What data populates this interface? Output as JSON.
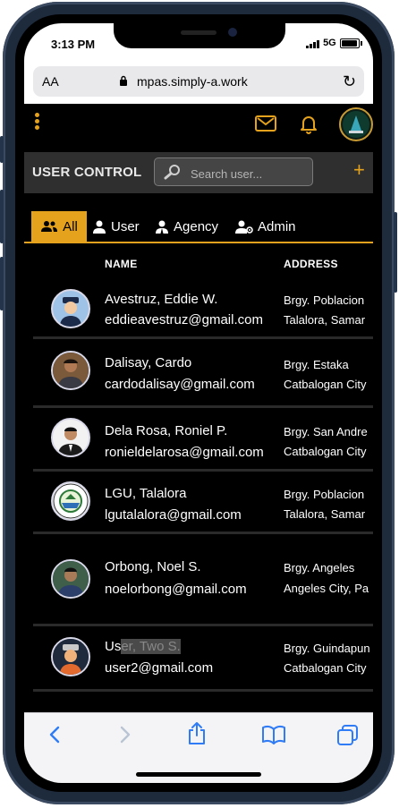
{
  "status_bar": {
    "time": "3:13 PM",
    "network": "5G"
  },
  "browser": {
    "text_size": "AA",
    "url": "mpas.simply-a.work"
  },
  "control": {
    "title": "USER CONTROL",
    "search_placeholder": "Search user..."
  },
  "tabs": [
    {
      "label": "All",
      "icon": "users-group-icon",
      "active": true
    },
    {
      "label": "User",
      "icon": "user-icon",
      "active": false
    },
    {
      "label": "Agency",
      "icon": "agency-user-icon",
      "active": false
    },
    {
      "label": "Admin",
      "icon": "admin-user-gear-icon",
      "active": false
    }
  ],
  "table": {
    "headers": {
      "name": "NAME",
      "address": "ADDRESS"
    },
    "rows": [
      {
        "name": "Avestruz, Eddie W.",
        "email": "eddieavestruz@gmail.com",
        "address_line1": "Brgy. Poblacion",
        "address_line2": "Talalora, Samar"
      },
      {
        "name": "Dalisay, Cardo",
        "email": "cardodalisay@gmail.com",
        "address_line1": "Brgy. Estaka",
        "address_line2": "Catbalogan City"
      },
      {
        "name": "Dela Rosa, Roniel P.",
        "email": "ronieldelarosa@gmail.com",
        "address_line1": "Brgy. San Andre",
        "address_line2": "Catbalogan City"
      },
      {
        "name": "LGU, Talalora",
        "email": "lgutalalora@gmail.com",
        "address_line1": "Brgy. Poblacion",
        "address_line2": "Talalora, Samar"
      },
      {
        "name": "Orbong, Noel S.",
        "email": "noelorbong@gmail.com",
        "address_line1": "Brgy. Angeles",
        "address_line2": "Angeles City, Pa"
      },
      {
        "name_part1": "Us",
        "name_part2": "er, Two S.",
        "email": "user2@gmail.com",
        "address_line1": "Brgy. Guindapun",
        "address_line2": "Catbalogan City"
      }
    ]
  },
  "colors": {
    "accent": "#e5a21c",
    "background": "#000000",
    "control_bar": "#2f2f2f",
    "browser_blue": "#2f7cf6"
  }
}
